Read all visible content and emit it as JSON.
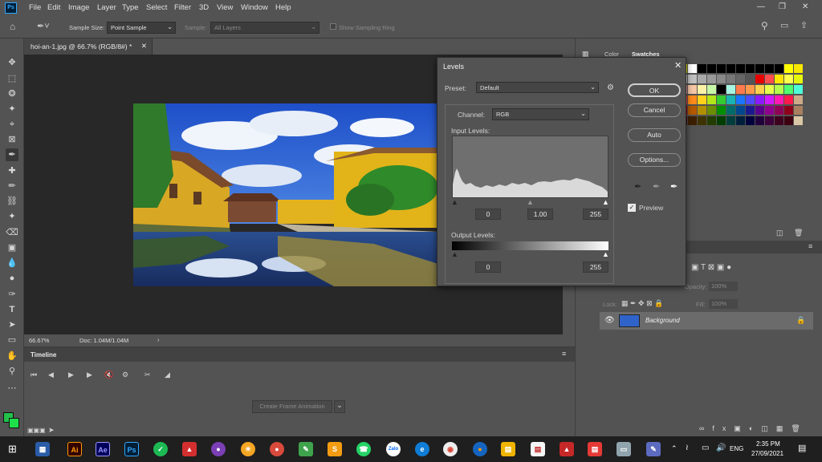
{
  "menubar": {
    "logo": "Ps",
    "items": [
      "File",
      "Edit",
      "Image",
      "Layer",
      "Type",
      "Select",
      "Filter",
      "3D",
      "View",
      "Window",
      "Help"
    ]
  },
  "options": {
    "sample_size_label": "Sample Size:",
    "sample_size_value": "Point Sample",
    "sample_label": "Sample:",
    "sample_value": "All Layers",
    "show_ring_label": "Show Sampling Ring"
  },
  "document": {
    "tab_title": "hoi-an-1.jpg @ 66.7% (RGB/8#) *",
    "zoom": "66.67%",
    "doc_info": "Doc: 1.04M/1.04M"
  },
  "timeline": {
    "title": "Timeline",
    "create_frame_label": "Create Frame Animation"
  },
  "panels": {
    "color_tab": "Color",
    "swatches_tab": "Swatches",
    "opacity_label": "Opacity:",
    "opacity_value": "100%",
    "lock_label": "Lock:",
    "fill_label": "Fill:",
    "fill_value": "100%",
    "layer_name": "Background"
  },
  "levels": {
    "title": "Levels",
    "preset_label": "Preset:",
    "preset_value": "Default",
    "channel_label": "Channel:",
    "channel_value": "RGB",
    "input_levels_label": "Input Levels:",
    "input_black": "0",
    "input_gamma": "1.00",
    "input_white": "255",
    "output_levels_label": "Output Levels:",
    "output_black": "0",
    "output_white": "255",
    "ok_label": "OK",
    "cancel_label": "Cancel",
    "auto_label": "Auto",
    "options_label": "Options...",
    "preview_label": "Preview",
    "preview_checked": true
  },
  "taskbar": {
    "language": "ENG",
    "time": "2:35 PM",
    "date": "27/09/2021"
  },
  "colors": {
    "accent": "#31a8ff",
    "foreground_swatch": "#22c14a",
    "background_swatch": "#1ddf4a"
  }
}
